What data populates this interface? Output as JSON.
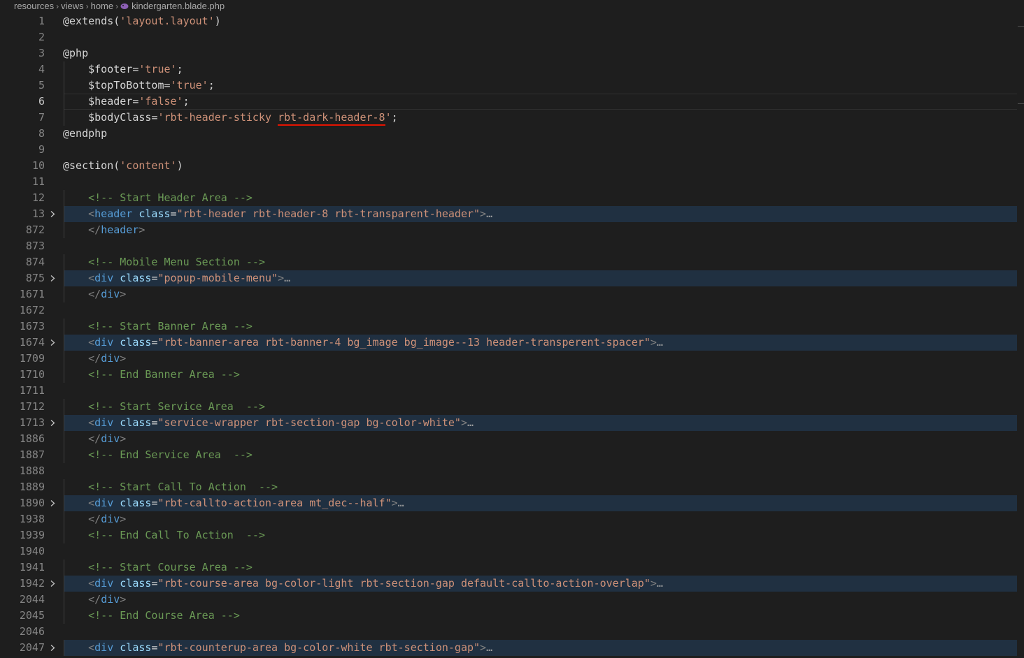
{
  "breadcrumb": {
    "items": [
      "resources",
      "views",
      "home"
    ],
    "file": "kindergarten.blade.php"
  },
  "colors": {
    "background": "#1e1e1e",
    "folded_highlight": "#203041",
    "comment": "#6a9955",
    "string": "#ce9178",
    "tag": "#569cd6",
    "attribute": "#9cdcfe",
    "underline": "#e51400"
  },
  "editor": {
    "current_line": "6",
    "lines": [
      {
        "num": "1",
        "text": "@extends('layout.layout')"
      },
      {
        "num": "2",
        "text": ""
      },
      {
        "num": "3",
        "text": "@php"
      },
      {
        "num": "4",
        "text": "    $footer='true';"
      },
      {
        "num": "5",
        "text": "    $topToBottom='true';"
      },
      {
        "num": "6",
        "text": "    $header='false';"
      },
      {
        "num": "7",
        "text": "    $bodyClass='rbt-header-sticky rbt-dark-header-8';"
      },
      {
        "num": "8",
        "text": "@endphp"
      },
      {
        "num": "9",
        "text": ""
      },
      {
        "num": "10",
        "text": "@section('content')"
      },
      {
        "num": "11",
        "text": ""
      },
      {
        "num": "12",
        "text": "    <!-- Start Header Area -->"
      },
      {
        "num": "13",
        "text": "    <header class=\"rbt-header rbt-header-8 rbt-transparent-header\">…"
      },
      {
        "num": "872",
        "text": "    </header>"
      },
      {
        "num": "873",
        "text": ""
      },
      {
        "num": "874",
        "text": "    <!-- Mobile Menu Section -->"
      },
      {
        "num": "875",
        "text": "    <div class=\"popup-mobile-menu\">…"
      },
      {
        "num": "1671",
        "text": "    </div>"
      },
      {
        "num": "1672",
        "text": ""
      },
      {
        "num": "1673",
        "text": "    <!-- Start Banner Area -->"
      },
      {
        "num": "1674",
        "text": "    <div class=\"rbt-banner-area rbt-banner-4 bg_image bg_image--13 header-transperent-spacer\">…"
      },
      {
        "num": "1709",
        "text": "    </div>"
      },
      {
        "num": "1710",
        "text": "    <!-- End Banner Area -->"
      },
      {
        "num": "1711",
        "text": ""
      },
      {
        "num": "1712",
        "text": "    <!-- Start Service Area  -->"
      },
      {
        "num": "1713",
        "text": "    <div class=\"service-wrapper rbt-section-gap bg-color-white\">…"
      },
      {
        "num": "1886",
        "text": "    </div>"
      },
      {
        "num": "1887",
        "text": "    <!-- End Service Area  -->"
      },
      {
        "num": "1888",
        "text": ""
      },
      {
        "num": "1889",
        "text": "    <!-- Start Call To Action  -->"
      },
      {
        "num": "1890",
        "text": "    <div class=\"rbt-callto-action-area mt_dec--half\">…"
      },
      {
        "num": "1938",
        "text": "    </div>"
      },
      {
        "num": "1939",
        "text": "    <!-- End Call To Action  -->"
      },
      {
        "num": "1940",
        "text": ""
      },
      {
        "num": "1941",
        "text": "    <!-- Start Course Area -->"
      },
      {
        "num": "1942",
        "text": "    <div class=\"rbt-course-area bg-color-light rbt-section-gap default-callto-action-overlap\">…"
      },
      {
        "num": "2044",
        "text": "    </div>"
      },
      {
        "num": "2045",
        "text": "    <!-- End Course Area -->"
      },
      {
        "num": "2046",
        "text": ""
      },
      {
        "num": "2047",
        "text": "    <div class=\"rbt-counterup-area bg-color-white rbt-section-gap\">…"
      }
    ]
  }
}
